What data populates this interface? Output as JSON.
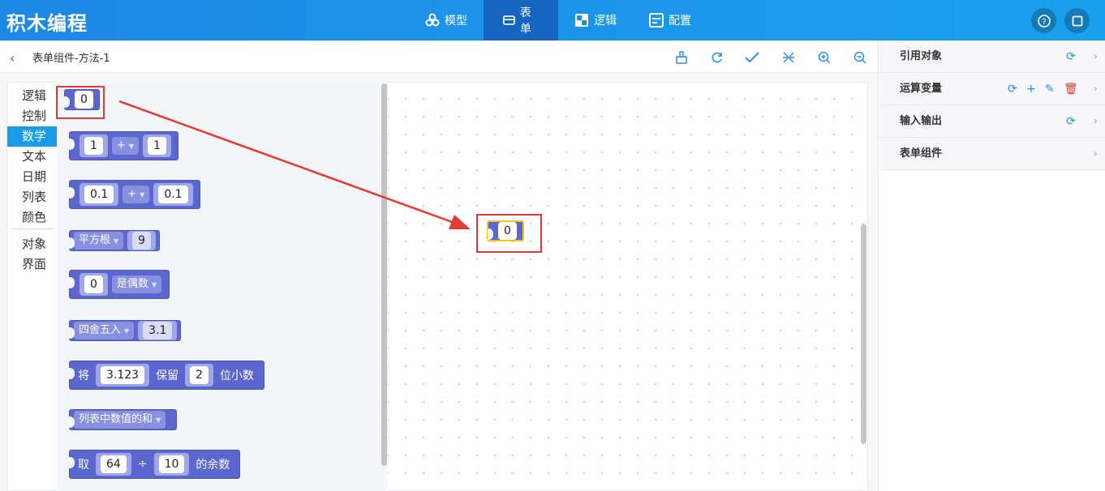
{
  "header": {
    "app_title": "积木编程",
    "tabs": [
      {
        "label": "模型",
        "icon": "cubes-icon"
      },
      {
        "label": "表单",
        "icon": "form-icon"
      },
      {
        "label": "逻辑",
        "icon": "puzzle-icon"
      },
      {
        "label": "配置",
        "icon": "settings-panel-icon"
      }
    ],
    "active_tab": "表单",
    "right_buttons": [
      "help-icon",
      "fullscreen-icon"
    ]
  },
  "subbar": {
    "breadcrumb": "表单组件-方法-1",
    "tools": [
      "clean-icon",
      "refresh-icon",
      "check-icon",
      "collapse-icon",
      "zoom-in-icon",
      "zoom-out-icon"
    ]
  },
  "toolbox": {
    "categories": [
      "逻辑",
      "控制",
      "数学",
      "文本",
      "日期",
      "列表",
      "颜色",
      "对象",
      "界面"
    ],
    "active_category": "数学"
  },
  "flyout": {
    "num_block": "0",
    "arith1": {
      "a": "1",
      "op": "+",
      "b": "1"
    },
    "arith2": {
      "a": "0.1",
      "op": "+",
      "b": "0.1"
    },
    "sqrt": {
      "fn": "平方根",
      "arg": "9"
    },
    "even": {
      "value": "0",
      "check": "是偶数"
    },
    "round": {
      "fn": "四舍五入",
      "arg": "3.1"
    },
    "tofixed": {
      "label1": "将",
      "value": "3.123",
      "label2": "保留",
      "digits": "2",
      "label3": "位小数"
    },
    "listsum": {
      "fn": "列表中数值的和"
    },
    "modulo": {
      "label1": "取",
      "a": "64",
      "op": "÷",
      "b": "10",
      "label2": "的余数"
    }
  },
  "canvas": {
    "placed_block_value": "0"
  },
  "right_panel": {
    "rows": [
      {
        "label": "引用对象"
      },
      {
        "label": "运算变量"
      },
      {
        "label": "输入输出"
      },
      {
        "label": "表单组件"
      }
    ]
  },
  "annotation_color": "#e53935"
}
